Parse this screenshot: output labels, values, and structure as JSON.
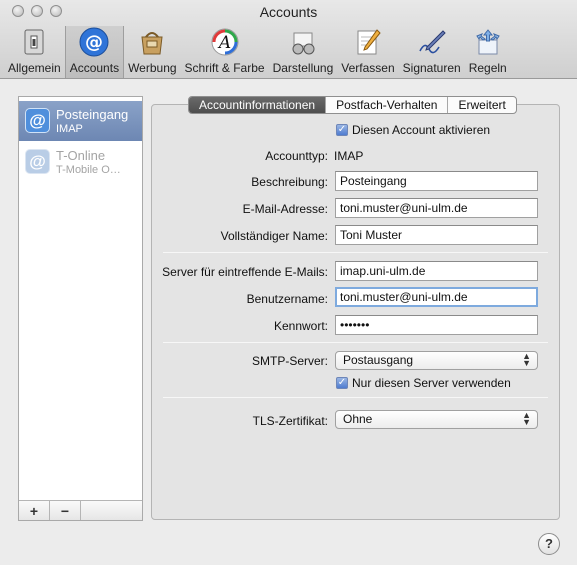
{
  "window": {
    "title": "Accounts"
  },
  "toolbar": {
    "items": [
      {
        "label": "Allgemein"
      },
      {
        "label": "Accounts"
      },
      {
        "label": "Werbung"
      },
      {
        "label": "Schrift & Farbe"
      },
      {
        "label": "Darstellung"
      },
      {
        "label": "Verfassen"
      },
      {
        "label": "Signaturen"
      },
      {
        "label": "Regeln"
      }
    ],
    "selected": "Accounts"
  },
  "sidebar": {
    "accounts": [
      {
        "name": "Posteingang",
        "type": "IMAP",
        "selected": true
      },
      {
        "name": "T-Online",
        "type": "T-Mobile O…",
        "selected": false
      }
    ],
    "add_label": "+",
    "remove_label": "−"
  },
  "tabs": [
    {
      "label": "Accountinformationen",
      "selected": true
    },
    {
      "label": "Postfach-Verhalten",
      "selected": false
    },
    {
      "label": "Erweitert",
      "selected": false
    }
  ],
  "form": {
    "enable_label": "Diesen Account aktivieren",
    "enable_checked": true,
    "account_type_label": "Accounttyp:",
    "account_type_value": "IMAP",
    "description_label": "Beschreibung:",
    "description_value": "Posteingang",
    "email_label": "E-Mail-Adresse:",
    "email_value": "toni.muster@uni-ulm.de",
    "fullname_label": "Vollständiger Name:",
    "fullname_value": "Toni Muster",
    "incoming_label": "Server für eintreffende E-Mails:",
    "incoming_value": "imap.uni-ulm.de",
    "username_label": "Benutzername:",
    "username_value": "toni.muster@uni-ulm.de",
    "password_label": "Kennwort:",
    "password_value": "•••••••",
    "smtp_label": "SMTP-Server:",
    "smtp_value": "Postausgang",
    "only_server_label": "Nur diesen Server verwenden",
    "only_server_checked": true,
    "tls_label": "TLS-Zertifikat:",
    "tls_value": "Ohne"
  },
  "help": {
    "label": "?"
  }
}
